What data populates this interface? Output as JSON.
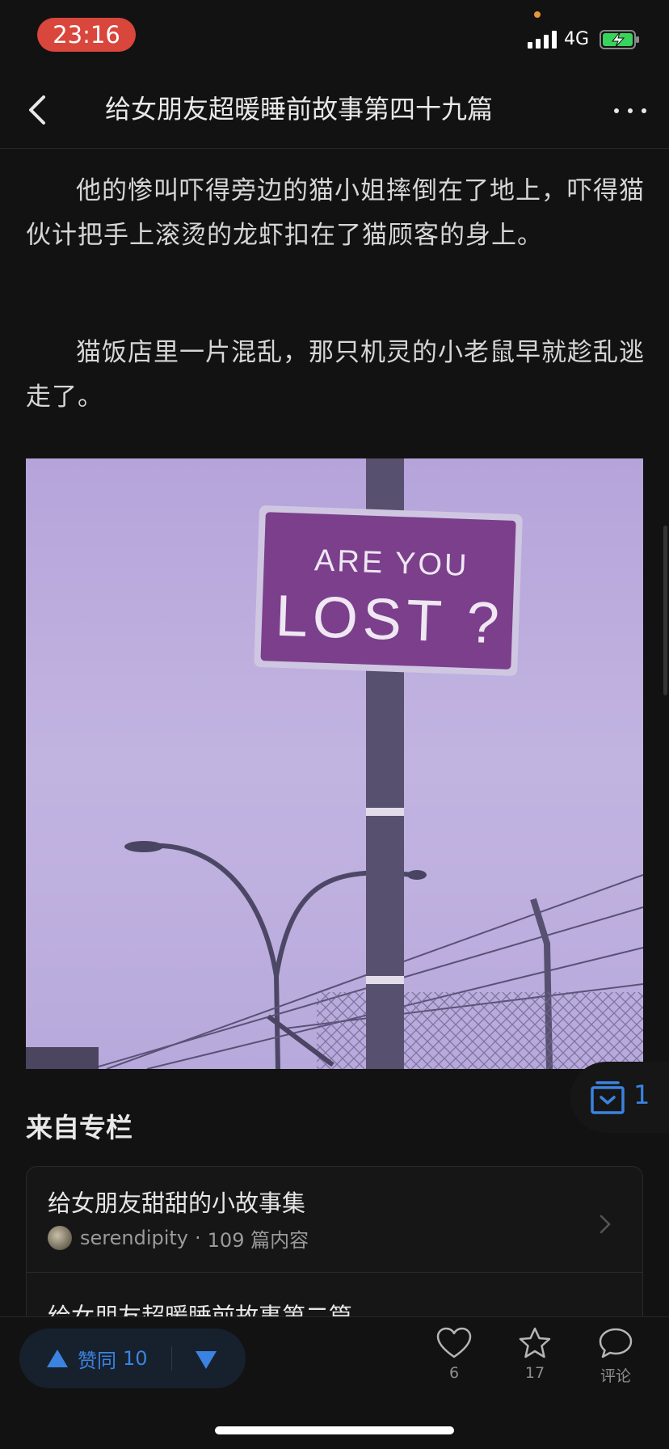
{
  "status_bar": {
    "time": "23:16",
    "network": "4G"
  },
  "nav": {
    "title": "给女朋友超暖睡前故事第四十九篇",
    "back_icon": "chevron-left-icon",
    "more_icon": "more-horizontal-icon"
  },
  "article": {
    "paragraphs": [
      "他的惨叫吓得旁边的猫小姐摔倒在了地上，吓得猫伙计把手上滚烫的龙虾扣在了猫顾客的身上。",
      "猫饭店里一片混乱，那只机灵的小老鼠早就趁乱逃走了。"
    ],
    "image": {
      "sign_line1": "ARE YOU",
      "sign_line2": "LOST ?"
    }
  },
  "collect": {
    "icon": "collection-icon",
    "count": "1"
  },
  "column": {
    "section_title": "来自专栏",
    "title": "给女朋友甜甜的小故事集",
    "author": "serendipity",
    "separator": "·",
    "article_count": "109 篇内容",
    "next_article": "给女朋友超暖睡前故事第二篇"
  },
  "bottom_bar": {
    "upvote_label": "赞同",
    "upvote_count": "10",
    "like_count": "6",
    "favorite_count": "17",
    "comment_label": "评论"
  },
  "colors": {
    "accent": "#3b83e0",
    "background": "#121212",
    "time_pill": "#d9463c"
  }
}
